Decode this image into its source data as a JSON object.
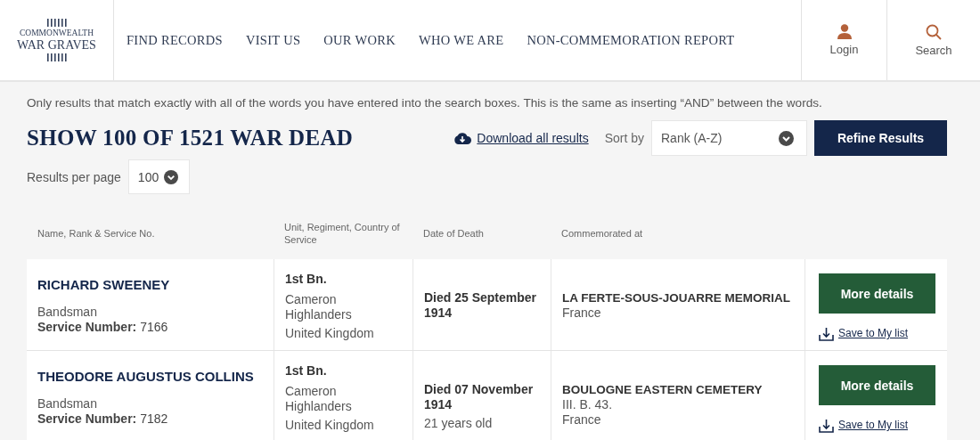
{
  "header": {
    "logo": {
      "line_1": "COMMONWEALTH",
      "line_2": "WAR GRAVES"
    },
    "nav": [
      "FIND RECORDS",
      "VISIT US",
      "OUR WORK",
      "WHO WE ARE",
      "NON-COMMEMORATION REPORT"
    ],
    "actions": [
      {
        "kind": "login",
        "label": "Login"
      },
      {
        "kind": "search",
        "label": "Search"
      }
    ]
  },
  "intro": "Only results that match exactly with all of the words you have entered into the search boxes. This is the same as inserting “AND” between the words.",
  "title": "SHOW 100 OF 1521 WAR DEAD",
  "download": "Download all results",
  "sort": {
    "label": "Sort by",
    "value": "Rank (A-Z)"
  },
  "refine_button": "Refine Results",
  "per_page": {
    "label": "Results per page",
    "value": "100"
  },
  "table": {
    "columns": [
      "Name, Rank & Service No.",
      "Unit, Regiment, Country of Service",
      "Date of Death",
      "Commemorated at"
    ],
    "rows": [
      {
        "name": "RICHARD SWEENEY",
        "rank": "Bandsman",
        "service_label": "Service Number:",
        "service_no": "7166",
        "unit": "1st Bn.",
        "regiment": "Cameron Highlanders",
        "country": "United Kingdom",
        "death": "Died 25 September 1914",
        "cemetery": "LA FERTE-SOUS-JOUARRE MEMORIAL",
        "cemetery_country": "France",
        "button": "More details",
        "save": "Save to My list"
      },
      {
        "name": "THEODORE AUGUSTUS COLLINS",
        "rank": "Bandsman",
        "service_label": "Service Number:",
        "service_no": "7182",
        "unit": "1st Bn.",
        "regiment": "Cameron Highlanders",
        "country": "United Kingdom",
        "death": "Died 07 November 1914",
        "age": "21 years old",
        "cemetery": "BOULOGNE EASTERN CEMETERY",
        "grave": "III. B. 43.",
        "cemetery_country": "France",
        "button": "More details",
        "save": "Save to My list"
      }
    ]
  }
}
